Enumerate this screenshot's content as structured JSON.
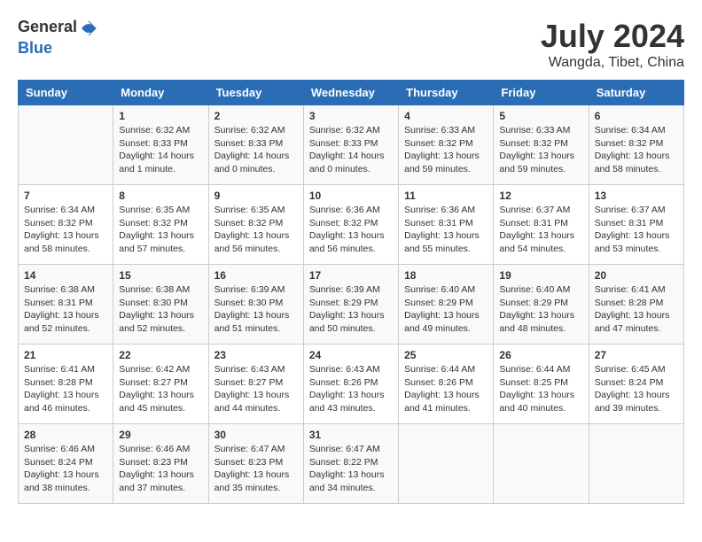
{
  "header": {
    "logo_general": "General",
    "logo_blue": "Blue",
    "month_year": "July 2024",
    "location": "Wangda, Tibet, China"
  },
  "days_of_week": [
    "Sunday",
    "Monday",
    "Tuesday",
    "Wednesday",
    "Thursday",
    "Friday",
    "Saturday"
  ],
  "weeks": [
    [
      {
        "day": "",
        "sunrise": "",
        "sunset": "",
        "daylight": ""
      },
      {
        "day": "1",
        "sunrise": "Sunrise: 6:32 AM",
        "sunset": "Sunset: 8:33 PM",
        "daylight": "Daylight: 14 hours and 1 minute."
      },
      {
        "day": "2",
        "sunrise": "Sunrise: 6:32 AM",
        "sunset": "Sunset: 8:33 PM",
        "daylight": "Daylight: 14 hours and 0 minutes."
      },
      {
        "day": "3",
        "sunrise": "Sunrise: 6:32 AM",
        "sunset": "Sunset: 8:33 PM",
        "daylight": "Daylight: 14 hours and 0 minutes."
      },
      {
        "day": "4",
        "sunrise": "Sunrise: 6:33 AM",
        "sunset": "Sunset: 8:32 PM",
        "daylight": "Daylight: 13 hours and 59 minutes."
      },
      {
        "day": "5",
        "sunrise": "Sunrise: 6:33 AM",
        "sunset": "Sunset: 8:32 PM",
        "daylight": "Daylight: 13 hours and 59 minutes."
      },
      {
        "day": "6",
        "sunrise": "Sunrise: 6:34 AM",
        "sunset": "Sunset: 8:32 PM",
        "daylight": "Daylight: 13 hours and 58 minutes."
      }
    ],
    [
      {
        "day": "7",
        "sunrise": "Sunrise: 6:34 AM",
        "sunset": "Sunset: 8:32 PM",
        "daylight": "Daylight: 13 hours and 58 minutes."
      },
      {
        "day": "8",
        "sunrise": "Sunrise: 6:35 AM",
        "sunset": "Sunset: 8:32 PM",
        "daylight": "Daylight: 13 hours and 57 minutes."
      },
      {
        "day": "9",
        "sunrise": "Sunrise: 6:35 AM",
        "sunset": "Sunset: 8:32 PM",
        "daylight": "Daylight: 13 hours and 56 minutes."
      },
      {
        "day": "10",
        "sunrise": "Sunrise: 6:36 AM",
        "sunset": "Sunset: 8:32 PM",
        "daylight": "Daylight: 13 hours and 56 minutes."
      },
      {
        "day": "11",
        "sunrise": "Sunrise: 6:36 AM",
        "sunset": "Sunset: 8:31 PM",
        "daylight": "Daylight: 13 hours and 55 minutes."
      },
      {
        "day": "12",
        "sunrise": "Sunrise: 6:37 AM",
        "sunset": "Sunset: 8:31 PM",
        "daylight": "Daylight: 13 hours and 54 minutes."
      },
      {
        "day": "13",
        "sunrise": "Sunrise: 6:37 AM",
        "sunset": "Sunset: 8:31 PM",
        "daylight": "Daylight: 13 hours and 53 minutes."
      }
    ],
    [
      {
        "day": "14",
        "sunrise": "Sunrise: 6:38 AM",
        "sunset": "Sunset: 8:31 PM",
        "daylight": "Daylight: 13 hours and 52 minutes."
      },
      {
        "day": "15",
        "sunrise": "Sunrise: 6:38 AM",
        "sunset": "Sunset: 8:30 PM",
        "daylight": "Daylight: 13 hours and 52 minutes."
      },
      {
        "day": "16",
        "sunrise": "Sunrise: 6:39 AM",
        "sunset": "Sunset: 8:30 PM",
        "daylight": "Daylight: 13 hours and 51 minutes."
      },
      {
        "day": "17",
        "sunrise": "Sunrise: 6:39 AM",
        "sunset": "Sunset: 8:29 PM",
        "daylight": "Daylight: 13 hours and 50 minutes."
      },
      {
        "day": "18",
        "sunrise": "Sunrise: 6:40 AM",
        "sunset": "Sunset: 8:29 PM",
        "daylight": "Daylight: 13 hours and 49 minutes."
      },
      {
        "day": "19",
        "sunrise": "Sunrise: 6:40 AM",
        "sunset": "Sunset: 8:29 PM",
        "daylight": "Daylight: 13 hours and 48 minutes."
      },
      {
        "day": "20",
        "sunrise": "Sunrise: 6:41 AM",
        "sunset": "Sunset: 8:28 PM",
        "daylight": "Daylight: 13 hours and 47 minutes."
      }
    ],
    [
      {
        "day": "21",
        "sunrise": "Sunrise: 6:41 AM",
        "sunset": "Sunset: 8:28 PM",
        "daylight": "Daylight: 13 hours and 46 minutes."
      },
      {
        "day": "22",
        "sunrise": "Sunrise: 6:42 AM",
        "sunset": "Sunset: 8:27 PM",
        "daylight": "Daylight: 13 hours and 45 minutes."
      },
      {
        "day": "23",
        "sunrise": "Sunrise: 6:43 AM",
        "sunset": "Sunset: 8:27 PM",
        "daylight": "Daylight: 13 hours and 44 minutes."
      },
      {
        "day": "24",
        "sunrise": "Sunrise: 6:43 AM",
        "sunset": "Sunset: 8:26 PM",
        "daylight": "Daylight: 13 hours and 43 minutes."
      },
      {
        "day": "25",
        "sunrise": "Sunrise: 6:44 AM",
        "sunset": "Sunset: 8:26 PM",
        "daylight": "Daylight: 13 hours and 41 minutes."
      },
      {
        "day": "26",
        "sunrise": "Sunrise: 6:44 AM",
        "sunset": "Sunset: 8:25 PM",
        "daylight": "Daylight: 13 hours and 40 minutes."
      },
      {
        "day": "27",
        "sunrise": "Sunrise: 6:45 AM",
        "sunset": "Sunset: 8:24 PM",
        "daylight": "Daylight: 13 hours and 39 minutes."
      }
    ],
    [
      {
        "day": "28",
        "sunrise": "Sunrise: 6:46 AM",
        "sunset": "Sunset: 8:24 PM",
        "daylight": "Daylight: 13 hours and 38 minutes."
      },
      {
        "day": "29",
        "sunrise": "Sunrise: 6:46 AM",
        "sunset": "Sunset: 8:23 PM",
        "daylight": "Daylight: 13 hours and 37 minutes."
      },
      {
        "day": "30",
        "sunrise": "Sunrise: 6:47 AM",
        "sunset": "Sunset: 8:23 PM",
        "daylight": "Daylight: 13 hours and 35 minutes."
      },
      {
        "day": "31",
        "sunrise": "Sunrise: 6:47 AM",
        "sunset": "Sunset: 8:22 PM",
        "daylight": "Daylight: 13 hours and 34 minutes."
      },
      {
        "day": "",
        "sunrise": "",
        "sunset": "",
        "daylight": ""
      },
      {
        "day": "",
        "sunrise": "",
        "sunset": "",
        "daylight": ""
      },
      {
        "day": "",
        "sunrise": "",
        "sunset": "",
        "daylight": ""
      }
    ]
  ]
}
